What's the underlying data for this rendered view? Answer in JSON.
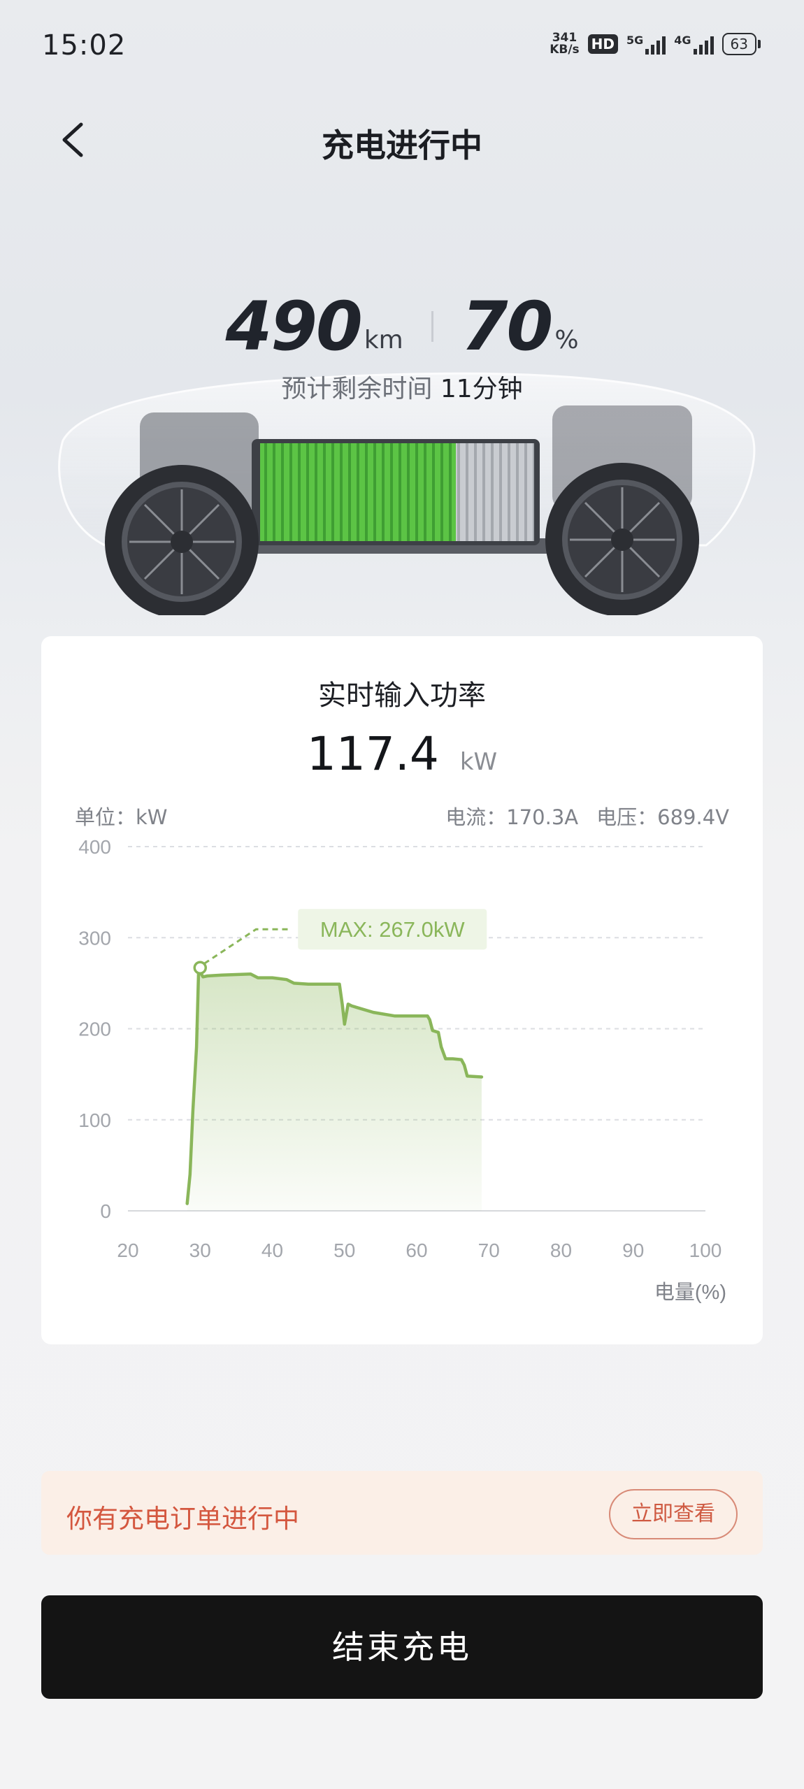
{
  "status_bar": {
    "time": "15:02",
    "net_speed_value": "341",
    "net_speed_unit": "KB/s",
    "hd_label": "HD",
    "signal_1_label": "5G",
    "signal_2_label": "4G",
    "battery_level": "63"
  },
  "header": {
    "title": "充电进行中",
    "back_icon": "chevron-left-icon"
  },
  "charge_stats": {
    "range_value": "490",
    "range_unit": "km",
    "soc_value": "70",
    "soc_unit": "%",
    "eta_label": "预计剩余时间",
    "eta_value": "11分钟",
    "battery_fill_fraction": 0.7
  },
  "power_card": {
    "title": "实时输入功率",
    "power_value": "117.4",
    "power_unit": "kW",
    "unit_label": "单位：kW",
    "current_label": "电流：170.3A",
    "voltage_label": "电压：689.4V"
  },
  "chart_data": {
    "type": "area",
    "xlabel": "电量(%)",
    "ylabel": "单位：kW",
    "xlim": [
      20,
      100
    ],
    "ylim": [
      0,
      400
    ],
    "x_ticks": [
      "20",
      "30",
      "40",
      "50",
      "60",
      "70",
      "80",
      "90",
      "100"
    ],
    "y_ticks": [
      "0",
      "100",
      "200",
      "300",
      "400"
    ],
    "grid": true,
    "line_color": "#8ab65a",
    "annotation": "MAX: 267.0kW",
    "max_point": [
      30,
      267
    ],
    "x": [
      28.2,
      28.6,
      29.0,
      29.5,
      29.8,
      30.0,
      30.4,
      31.0,
      33.0,
      37.0,
      38.0,
      40.0,
      42.0,
      43.0,
      45.0,
      47.0,
      49.3,
      49.7,
      50.0,
      50.5,
      51.0,
      54.0,
      57.0,
      60.0,
      61.5,
      61.8,
      62.2,
      63.0,
      63.4,
      64.0,
      65.0,
      66.2,
      66.6,
      67.0,
      69.0
    ],
    "y": [
      8,
      40,
      110,
      180,
      267,
      262,
      257,
      258,
      259,
      260,
      256,
      256,
      254,
      250,
      249,
      249,
      249,
      226,
      205,
      227,
      225,
      218,
      214,
      214,
      214,
      210,
      198,
      196,
      180,
      167,
      167,
      166,
      160,
      148,
      147
    ]
  },
  "notice": {
    "text": "你有充电订单进行中",
    "button_label": "立即查看"
  },
  "actions": {
    "end_label": "结束充电"
  }
}
